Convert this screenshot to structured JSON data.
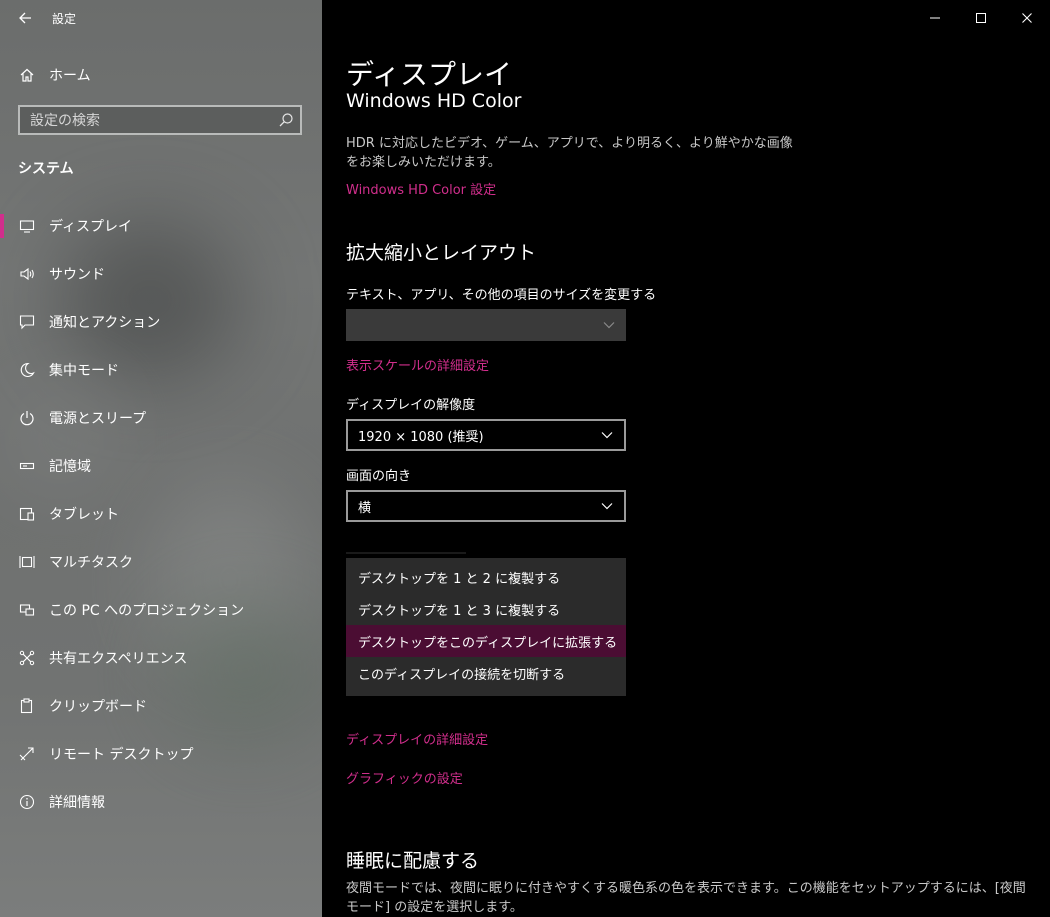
{
  "window": {
    "title": "設定",
    "controls": {
      "minimize_icon": "minimize-icon",
      "maximize_icon": "maximize-icon",
      "close_icon": "close-icon"
    }
  },
  "sidebar": {
    "home_label": "ホーム",
    "search_placeholder": "設定の検索",
    "section_title": "システム",
    "items": [
      {
        "label": "ディスプレイ",
        "icon": "monitor-icon",
        "selected": true
      },
      {
        "label": "サウンド",
        "icon": "speaker-icon"
      },
      {
        "label": "通知とアクション",
        "icon": "notification-icon"
      },
      {
        "label": "集中モード",
        "icon": "moon-icon"
      },
      {
        "label": "電源とスリープ",
        "icon": "power-icon"
      },
      {
        "label": "記憶域",
        "icon": "storage-icon"
      },
      {
        "label": "タブレット",
        "icon": "tablet-icon"
      },
      {
        "label": "マルチタスク",
        "icon": "multitask-icon"
      },
      {
        "label": "この PC へのプロジェクション",
        "icon": "projection-icon"
      },
      {
        "label": "共有エクスペリエンス",
        "icon": "shared-experience-icon"
      },
      {
        "label": "クリップボード",
        "icon": "clipboard-icon"
      },
      {
        "label": "リモート デスクトップ",
        "icon": "remote-desktop-icon"
      },
      {
        "label": "詳細情報",
        "icon": "info-icon"
      }
    ]
  },
  "main": {
    "page_title": "ディスプレイ",
    "hdr": {
      "heading": "Windows HD Color",
      "description": "HDR に対応したビデオ、ゲーム、アプリで、より明るく、より鮮やかな画像をお楽しみいただけます。",
      "link": "Windows HD Color 設定"
    },
    "scale_layout": {
      "heading": "拡大縮小とレイアウト",
      "size_label": "テキスト、アプリ、その他の項目のサイズを変更する",
      "size_value": "",
      "advanced_scaling_link": "表示スケールの詳細設定",
      "resolution_label": "ディスプレイの解像度",
      "resolution_value": "1920 × 1080 (推奨)",
      "orientation_label": "画面の向き",
      "orientation_value": "横"
    },
    "multiple_displays_menu": {
      "options": [
        "デスクトップを 1 と 2 に複製する",
        "デスクトップを 1 と 3 に複製する",
        "デスクトップをこのディスプレイに拡張する",
        "このディスプレイの接続を切断する"
      ],
      "highlighted": "デスクトップをこのディスプレイに拡張する"
    },
    "advanced_display_link": "ディスプレイの詳細設定",
    "graphics_link": "グラフィックの設定",
    "sleep": {
      "heading": "睡眠に配慮する",
      "description": "夜間モードでは、夜間に眠りに付きやすくする暖色系の色を表示できます。この機能をセットアップするには、[夜間モード] の設定を選択します。"
    }
  },
  "colors": {
    "accent": "#d12e8c",
    "menu_highlight": "#4b0d33",
    "background": "#000000"
  }
}
